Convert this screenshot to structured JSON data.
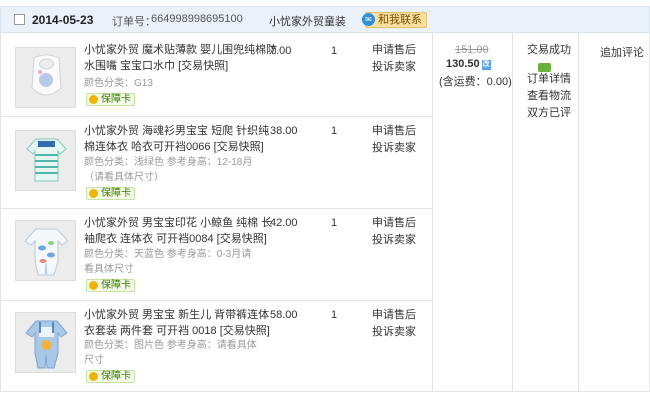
{
  "order_header": {
    "date": "2014-05-23",
    "order_label": "订单号：",
    "order_number": "664998998695100",
    "shop_name": "小忧家外贸童装",
    "contact_button": "和我联系"
  },
  "items": [
    {
      "title": "小忧家外贸 魔术贴薄款 婴儿围兜纯棉防水围嘴 宝宝口水巾 [交易快照]",
      "meta": "颜色分类：G13",
      "badge": "保障卡",
      "price": "7.00",
      "qty": "1",
      "action1": "申请售后",
      "action2": "投诉卖家"
    },
    {
      "title": "小忧家外贸 海魂衫男宝宝 短爬 针织纯棉连体衣 哈衣可开裆0066 [交易快照]",
      "meta": "颜色分类：浅绿色 参考身高：12-18月 （请看具体尺寸）",
      "badge": "保障卡",
      "price": "38.00",
      "qty": "1",
      "action1": "申请售后",
      "action2": "投诉卖家"
    },
    {
      "title": "小忧家外贸 男宝宝印花 小鲸鱼 纯棉 长袖爬衣 连体衣 可开裆0084 [交易快照]",
      "meta": "颜色分类：天蓝色 参考身高：0-3月请看具体尺寸",
      "badge": "保障卡",
      "price": "42.00",
      "qty": "1",
      "action1": "申请售后",
      "action2": "投诉卖家"
    },
    {
      "title": "小忧家外贸 男宝宝 新生儿 背带裤连体衣套装 两件套 可开裆 0018 [交易快照]",
      "meta": "颜色分类：图片色 参考身高：请看具体尺寸",
      "badge": "保障卡",
      "price": "58.00",
      "qty": "1",
      "action1": "申请售后",
      "action2": "投诉卖家"
    }
  ],
  "payment": {
    "original_price": "151.00",
    "total": "130.50",
    "total_tag": "改",
    "shipping": "(含运费：0.00)"
  },
  "status": {
    "state": "交易成功",
    "order_detail": "订单详情",
    "logistics": "查看物流",
    "rated": "双方已评"
  },
  "review": {
    "label": "追加评论"
  },
  "icons": {
    "checkbox": "checkbox-icon",
    "contact": "chat-bubble-icon",
    "message": "message-icon",
    "badge": "shield-coin-icon"
  },
  "colors": {
    "header_bg": "#eaf1fb",
    "contact_bg": "#f9e0a0",
    "badge_green": "#3d7a00",
    "border": "#e4e4e4"
  }
}
